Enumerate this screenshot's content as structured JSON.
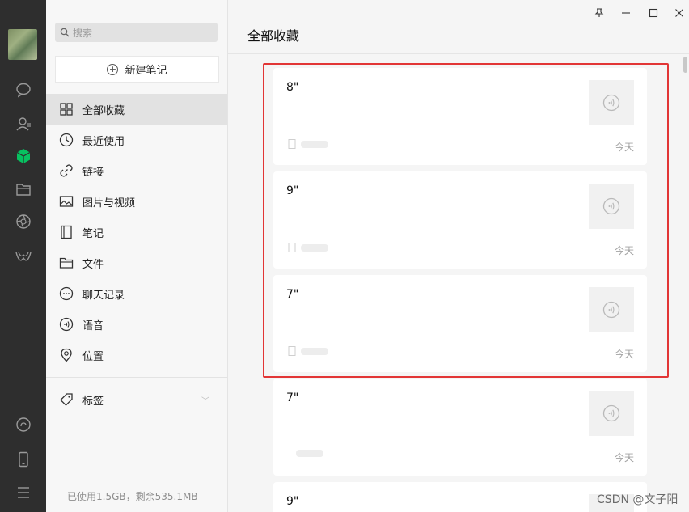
{
  "rail": {
    "icons": [
      "chat-icon",
      "contacts-icon",
      "favorites-icon",
      "folder-icon",
      "moments-icon",
      "miniprogram-icon",
      "mini-program-icon",
      "phone-icon",
      "menu-icon"
    ]
  },
  "sidebar": {
    "search_placeholder": "搜索",
    "new_note_label": "新建笔记",
    "items": [
      {
        "label": "全部收藏",
        "icon": "grid-icon"
      },
      {
        "label": "最近使用",
        "icon": "clock-icon"
      },
      {
        "label": "链接",
        "icon": "link-icon"
      },
      {
        "label": "图片与视频",
        "icon": "image-icon"
      },
      {
        "label": "笔记",
        "icon": "notebook-icon"
      },
      {
        "label": "文件",
        "icon": "folder-icon"
      },
      {
        "label": "聊天记录",
        "icon": "chat-record-icon"
      },
      {
        "label": "语音",
        "icon": "voice-icon"
      },
      {
        "label": "位置",
        "icon": "location-icon"
      }
    ],
    "tags_label": "标签",
    "storage": "已使用1.5GB，剩余535.1MB"
  },
  "main": {
    "title": "全部收藏",
    "cards": [
      {
        "duration": "8\"",
        "date": "今天"
      },
      {
        "duration": "9\"",
        "date": "今天"
      },
      {
        "duration": "7\"",
        "date": "今天"
      },
      {
        "duration": "7\"",
        "date": "今天"
      },
      {
        "duration": "9\"",
        "date": ""
      }
    ]
  },
  "watermark": "CSDN @文子阳",
  "colors": {
    "highlight": "#e23636",
    "accent": "#07c160"
  }
}
